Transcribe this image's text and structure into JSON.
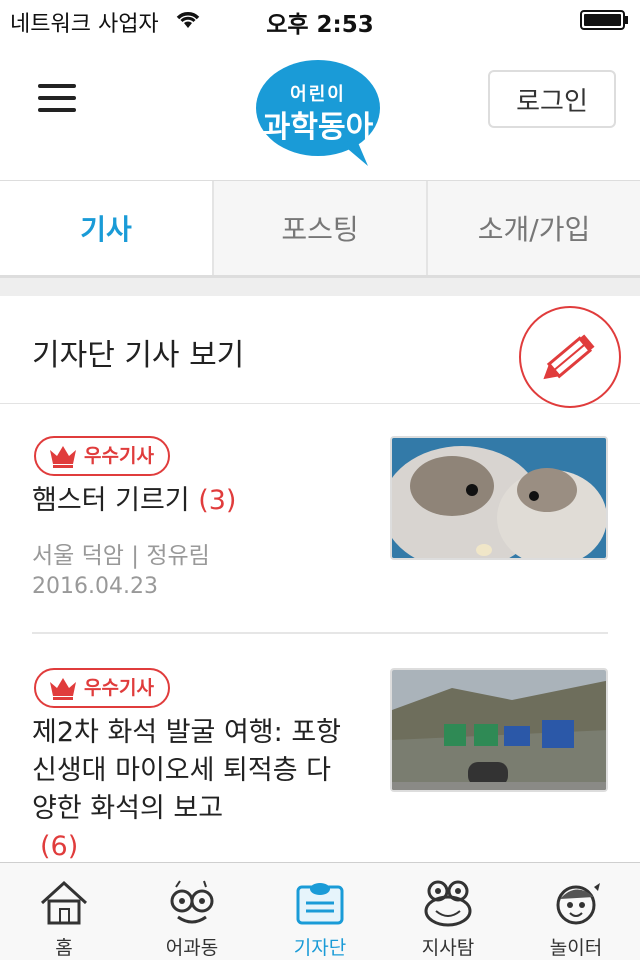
{
  "status_bar": {
    "carrier": "네트워크 사업자",
    "time": "오후 2:53"
  },
  "header": {
    "logo_top": "어린이",
    "logo_main": "과학동아",
    "login_label": "로그인"
  },
  "tabs": [
    {
      "label": "기사",
      "active": true
    },
    {
      "label": "포스팅",
      "active": false
    },
    {
      "label": "소개/가입",
      "active": false
    }
  ],
  "section": {
    "title": "기자단 기사 보기"
  },
  "articles": [
    {
      "badge": "우수기사",
      "title": "햄스터 기르기",
      "comments": "(3)",
      "author": "서울 덕암 | 정유림",
      "date": "2016.04.23"
    },
    {
      "badge": "우수기사",
      "title": "제2차 화석 발굴 여행: 포항 신생대 마이오세 퇴적층 다양한 화석의 보고",
      "comments": "(6)"
    }
  ],
  "bottom_nav": [
    {
      "label": "홈",
      "icon": "home-icon"
    },
    {
      "label": "어과동",
      "icon": "glasses-character-icon"
    },
    {
      "label": "기자단",
      "icon": "reporter-card-icon",
      "active": true
    },
    {
      "label": "지사탐",
      "icon": "frog-icon"
    },
    {
      "label": "놀이터",
      "icon": "girl-character-icon"
    }
  ],
  "colors": {
    "accent": "#1a9bd7",
    "badge_red": "#e03c3c",
    "logo_blue": "#1a9bd7"
  }
}
